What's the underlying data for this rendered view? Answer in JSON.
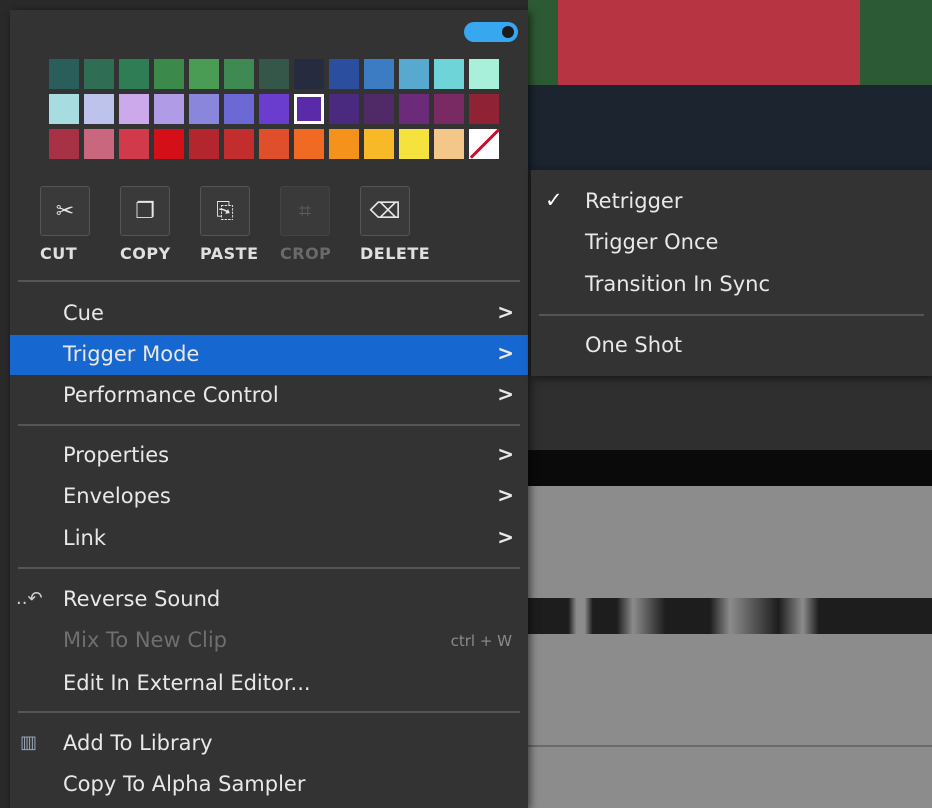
{
  "toggle": {
    "on": true,
    "color": "#37a8f0"
  },
  "palette": {
    "rows": [
      [
        "#2a5e5a",
        "#2f6e55",
        "#2e7d55",
        "#3b8a4c",
        "#4a9c55",
        "#3e8a52",
        "#34574a",
        "#272b3f",
        "#2b4e9e",
        "#3b7cc2",
        "#57a9cf",
        "#6fd4d8",
        "#a8f0da"
      ],
      [
        "#a7dde0",
        "#bdc3eb",
        "#cba9ea",
        "#b09be6",
        "#8a86dc",
        "#6c68d4",
        "#6a3dcf",
        "#5b2aa8",
        "#4a2a7e",
        "#4f2a67",
        "#6b2a7a",
        "#7a2a62",
        "#8f2335"
      ],
      [
        "#a73246",
        "#c9677e",
        "#d03a4b",
        "#d40f17",
        "#b3262e",
        "#c22d2d",
        "#e04f2b",
        "#f06a24",
        "#f5921c",
        "#f7b928",
        "#f5e23c",
        "#f3c789",
        "none"
      ]
    ],
    "selected": "#5b2aa8"
  },
  "tools": [
    {
      "name": "cut",
      "label": "CUT",
      "icon": "scissors-icon",
      "glyph": "✂",
      "disabled": false
    },
    {
      "name": "copy",
      "label": "COPY",
      "icon": "copy-icon",
      "glyph": "❐",
      "disabled": false
    },
    {
      "name": "paste",
      "label": "PASTE",
      "icon": "clipboard-icon",
      "glyph": "⎘",
      "disabled": false
    },
    {
      "name": "crop",
      "label": "CROP",
      "icon": "crop-icon",
      "glyph": "⌗",
      "disabled": true
    },
    {
      "name": "delete",
      "label": "DELETE",
      "icon": "backspace-icon",
      "glyph": "⌫",
      "disabled": false
    }
  ],
  "menu": {
    "cue": {
      "label": "Cue",
      "arrow": ">"
    },
    "trigger_mode": {
      "label": "Trigger Mode",
      "arrow": ">"
    },
    "performance_control": {
      "label": "Performance Control",
      "arrow": ">"
    },
    "properties": {
      "label": "Properties",
      "arrow": ">"
    },
    "envelopes": {
      "label": "Envelopes",
      "arrow": ">"
    },
    "link": {
      "label": "Link",
      "arrow": ">"
    },
    "reverse_sound": {
      "label": "Reverse Sound",
      "icon": "reverse-icon"
    },
    "mix_to_new_clip": {
      "label": "Mix To New Clip",
      "shortcut": "ctrl + W"
    },
    "edit_external": {
      "label": "Edit In External Editor..."
    },
    "add_to_library": {
      "label": "Add To Library",
      "icon": "library-icon"
    },
    "copy_to_alpha": {
      "label": "Copy To Alpha Sampler"
    }
  },
  "submenu": {
    "retrigger": {
      "label": "Retrigger",
      "check": "✓",
      "checked": true
    },
    "trigger_once": {
      "label": "Trigger Once"
    },
    "transition_in_sync": {
      "label": "Transition In Sync"
    },
    "one_shot": {
      "label": "One Shot"
    }
  },
  "colors": {
    "highlight": "#1767d1",
    "menu_bg": "#333333"
  }
}
